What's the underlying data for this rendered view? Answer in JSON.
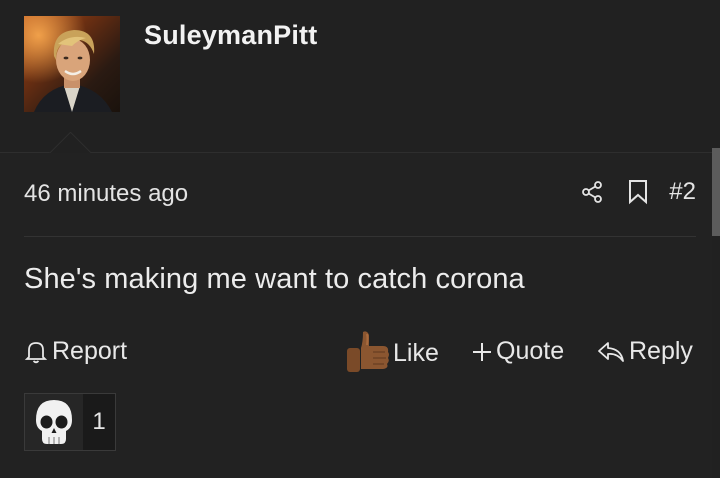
{
  "user": {
    "name": "SuleymanPitt",
    "avatar_icon": "user-avatar-photo"
  },
  "post": {
    "time": "46 minutes ago",
    "number": "#2",
    "message": "She's making me want to catch corona"
  },
  "actions": {
    "report": "Report",
    "like": "Like",
    "quote": "Quote",
    "reply": "Reply"
  },
  "reactions": {
    "emoji_icon": "skull-icon",
    "count": "1"
  },
  "colors": {
    "background": "#212121",
    "text": "#e8e8e8",
    "divider": "#333333"
  }
}
